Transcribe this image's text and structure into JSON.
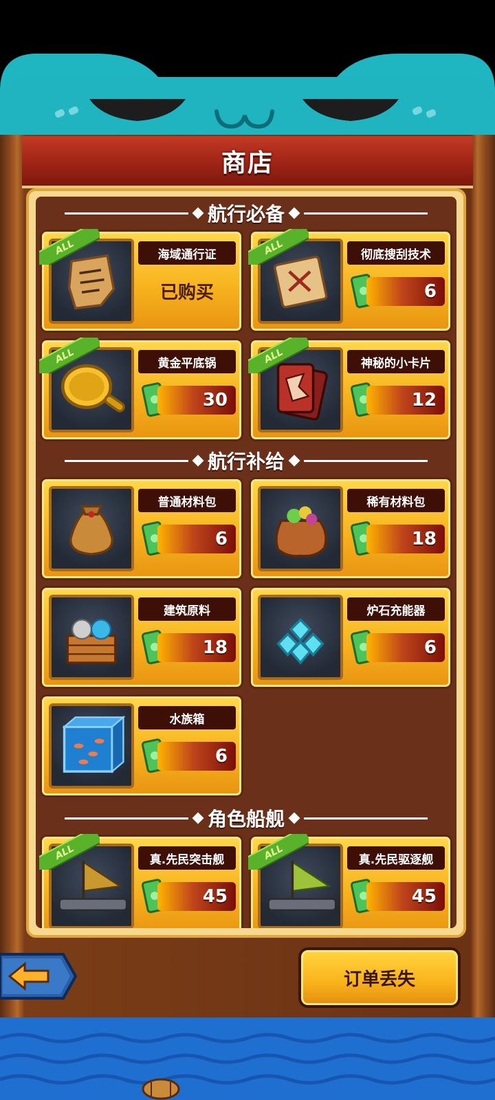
{
  "header": {
    "title": "商店"
  },
  "sections": [
    {
      "title": "航行必备",
      "items": [
        {
          "name": "海域通行证",
          "status": "已购买",
          "all_badge": "ALL",
          "icon": "map-scroll-icon"
        },
        {
          "name": "彻底搜刮技术",
          "price": "6",
          "all_badge": "ALL",
          "icon": "treasure-scroll-icon"
        },
        {
          "name": "黄金平底锅",
          "price": "30",
          "all_badge": "ALL",
          "icon": "frying-pan-icon"
        },
        {
          "name": "神秘的小卡片",
          "price": "12",
          "all_badge": "ALL",
          "icon": "dragon-cards-icon"
        }
      ]
    },
    {
      "title": "航行补给",
      "items": [
        {
          "name": "普通材料包",
          "price": "6",
          "icon": "common-bag-icon"
        },
        {
          "name": "稀有材料包",
          "price": "18",
          "icon": "rare-bag-icon"
        },
        {
          "name": "建筑原料",
          "price": "18",
          "icon": "material-crate-icon"
        },
        {
          "name": "炉石充能器",
          "price": "6",
          "icon": "crystal-icon"
        },
        {
          "name": "水族箱",
          "price": "6",
          "icon": "aquarium-icon"
        }
      ]
    },
    {
      "title": "角色船舰",
      "items": [
        {
          "name": "真.先民突击舰",
          "price": "45",
          "all_badge": "ALL",
          "icon": "ship-icon"
        },
        {
          "name": "真.先民驱逐舰",
          "price": "45",
          "all_badge": "ALL",
          "icon": "ship-green-icon"
        }
      ]
    }
  ],
  "footer": {
    "order_lost_label": "订单丢失"
  },
  "colors": {
    "card_gold": "#f7b41e",
    "panel_brown": "#6a3019",
    "title_red": "#9e2416",
    "header_teal": "#1fb6c2"
  }
}
